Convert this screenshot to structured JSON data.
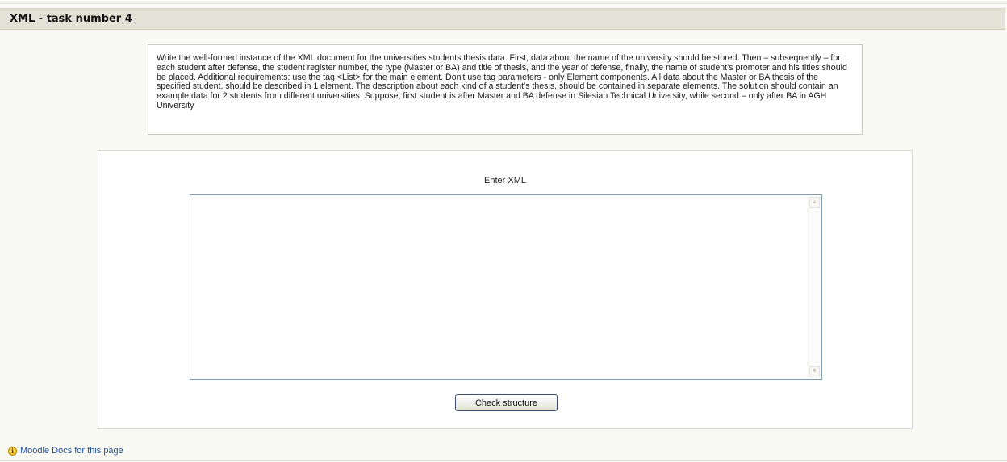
{
  "header": {
    "title": "XML - task number 4"
  },
  "task": {
    "description": "Write the well-formed instance of the XML document for the universities students thesis data. First, data about the name of the university should be stored. Then – subsequently – for each student after defense, the student register number, the type (Master or BA) and title of thesis, and the year of defense, finally, the name of student’s promoter and his titles should be placed. Additional requirements: use the tag <List> for the main element. Don't use tag parameters - only Element components. All data about the Master or BA thesis of the specified student, should be described in 1 element. The description about each kind of a student’s thesis, should be contained in separate elements. The solution should contain an example data for 2 students from different universities. Suppose, first student is after Master and BA defense in Silesian Technical University, while second – only after BA in AGH University"
  },
  "form": {
    "label": "Enter XML",
    "xml_value": "",
    "check_button": "Check structure"
  },
  "footer": {
    "info_icon_glyph": "i",
    "docs_link": "Moodle Docs for this page"
  },
  "colors": {
    "header_bg": "#e2e2d6",
    "page_bg": "#fafaf5",
    "link": "#1f4f9f",
    "textarea_border": "#7f9db9"
  }
}
